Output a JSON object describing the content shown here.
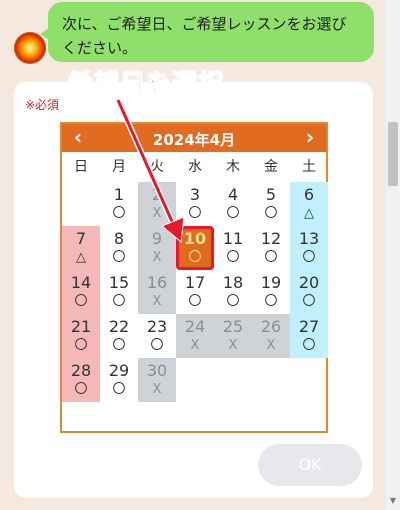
{
  "chat": {
    "message": "次に、ご希望日、ご希望レッスンをお選びください。"
  },
  "annotation": {
    "text": "希望日を選択"
  },
  "form": {
    "required_label": "※必須",
    "ok_label": "OK"
  },
  "calendar": {
    "title": "2024年4月",
    "prev_icon": "‹",
    "next_icon": "›",
    "weekdays": [
      "日",
      "月",
      "火",
      "水",
      "木",
      "金",
      "土"
    ],
    "weeks": [
      [
        null,
        {
          "day": "1",
          "mark": "〇",
          "status": "open"
        },
        {
          "day": "2",
          "mark": "X",
          "status": "closed"
        },
        {
          "day": "3",
          "mark": "〇",
          "status": "open"
        },
        {
          "day": "4",
          "mark": "〇",
          "status": "open"
        },
        {
          "day": "5",
          "mark": "〇",
          "status": "open"
        },
        {
          "day": "6",
          "mark": "△",
          "status": "open"
        }
      ],
      [
        {
          "day": "7",
          "mark": "△",
          "status": "open"
        },
        {
          "day": "8",
          "mark": "〇",
          "status": "open"
        },
        {
          "day": "9",
          "mark": "X",
          "status": "closed"
        },
        {
          "day": "10",
          "mark": "〇",
          "status": "selected"
        },
        {
          "day": "11",
          "mark": "〇",
          "status": "open"
        },
        {
          "day": "12",
          "mark": "〇",
          "status": "open"
        },
        {
          "day": "13",
          "mark": "〇",
          "status": "open"
        }
      ],
      [
        {
          "day": "14",
          "mark": "〇",
          "status": "open"
        },
        {
          "day": "15",
          "mark": "〇",
          "status": "open"
        },
        {
          "day": "16",
          "mark": "X",
          "status": "closed"
        },
        {
          "day": "17",
          "mark": "〇",
          "status": "open"
        },
        {
          "day": "18",
          "mark": "〇",
          "status": "open"
        },
        {
          "day": "19",
          "mark": "〇",
          "status": "open"
        },
        {
          "day": "20",
          "mark": "〇",
          "status": "open"
        }
      ],
      [
        {
          "day": "21",
          "mark": "〇",
          "status": "open"
        },
        {
          "day": "22",
          "mark": "〇",
          "status": "open"
        },
        {
          "day": "23",
          "mark": "〇",
          "status": "open"
        },
        {
          "day": "24",
          "mark": "X",
          "status": "closed"
        },
        {
          "day": "25",
          "mark": "X",
          "status": "closed"
        },
        {
          "day": "26",
          "mark": "X",
          "status": "closed"
        },
        {
          "day": "27",
          "mark": "〇",
          "status": "open"
        }
      ],
      [
        {
          "day": "28",
          "mark": "〇",
          "status": "open"
        },
        {
          "day": "29",
          "mark": "〇",
          "status": "open"
        },
        {
          "day": "30",
          "mark": "X",
          "status": "closed"
        },
        null,
        null,
        null,
        null
      ]
    ]
  },
  "colors": {
    "header": "#e16b21",
    "sunday": "#f4b8b8",
    "saturday": "#bff0fb",
    "closed": "#cfd3d8",
    "highlight": "#e8182a",
    "bubble": "#8fdf6b"
  }
}
